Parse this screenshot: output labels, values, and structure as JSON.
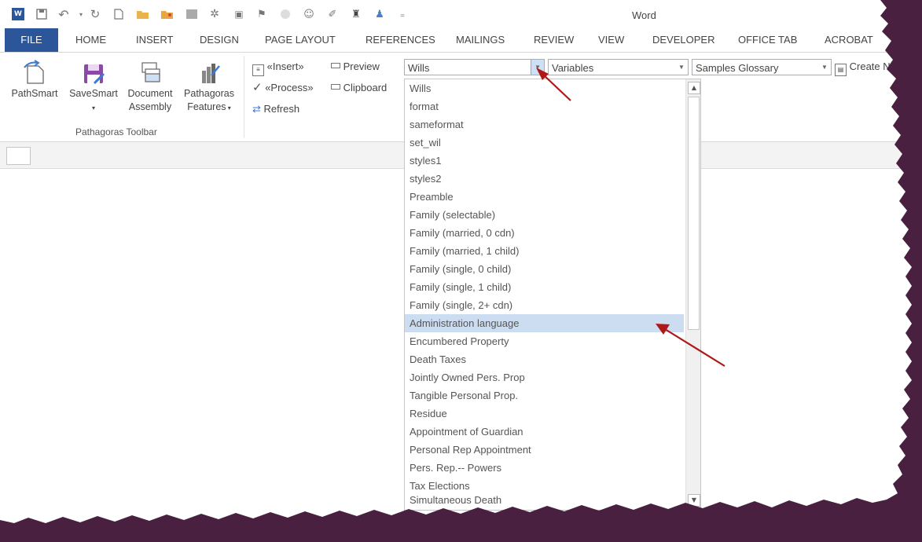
{
  "app": {
    "title": "Word"
  },
  "tabs": [
    "FILE",
    "HOME",
    "INSERT",
    "DESIGN",
    "PAGE LAYOUT",
    "REFERENCES",
    "MAILINGS",
    "REVIEW",
    "VIEW",
    "DEVELOPER",
    "OFFICE TAB",
    "ACROBAT"
  ],
  "ribbon": {
    "pathsmart": "PathSmart",
    "savesmart": "SaveSmart",
    "document_l1": "Document",
    "document_l2": "Assembly",
    "pathagoras_l1": "Pathagoras",
    "pathagoras_l2": "Features",
    "group_label": "Pathagoras Toolbar",
    "insert": "«Insert»",
    "process": "«Process»",
    "refresh": "Refresh",
    "preview": "Preview",
    "clipboard": "Clipboard",
    "combo_wills": "Wills",
    "combo_variables": "Variables",
    "combo_glossary": "Samples Glossary",
    "create": "Create N"
  },
  "dropdown": {
    "items": [
      "Wills",
      "format",
      "sameformat",
      "set_wil",
      "styles1",
      "styles2",
      "Preamble",
      "Family (selectable)",
      "Family (married, 0 cdn)",
      "Family  (married, 1 child)",
      "Family  (single, 0 child)",
      "Family  (single, 1 child)",
      "Family (single, 2+ cdn)",
      "Administration language",
      "Encumbered Property",
      "Death Taxes",
      "Jointly Owned Pers. Prop",
      "Tangible Personal Prop.",
      "Residue",
      "Appointment of Guardian",
      "Personal Rep Appointment",
      "Pers. Rep.-- Powers",
      "Tax Elections",
      "Simultaneous Death"
    ],
    "selected_index": 13
  },
  "colors": {
    "accent": "#2b579a",
    "selection": "#cdddf1",
    "frame": "#4a2040",
    "arrow": "#b01818"
  },
  "icons": [
    "word-icon",
    "save-icon",
    "undo-icon",
    "redo-icon",
    "new-doc-icon",
    "open-folder-icon",
    "folder-icon",
    "grid-icon",
    "fields-icon",
    "preview-icon",
    "flag-icon",
    "circle-icon",
    "people-icon",
    "wand-icon",
    "binoculars-icon",
    "users-icon",
    "customize-icon"
  ]
}
